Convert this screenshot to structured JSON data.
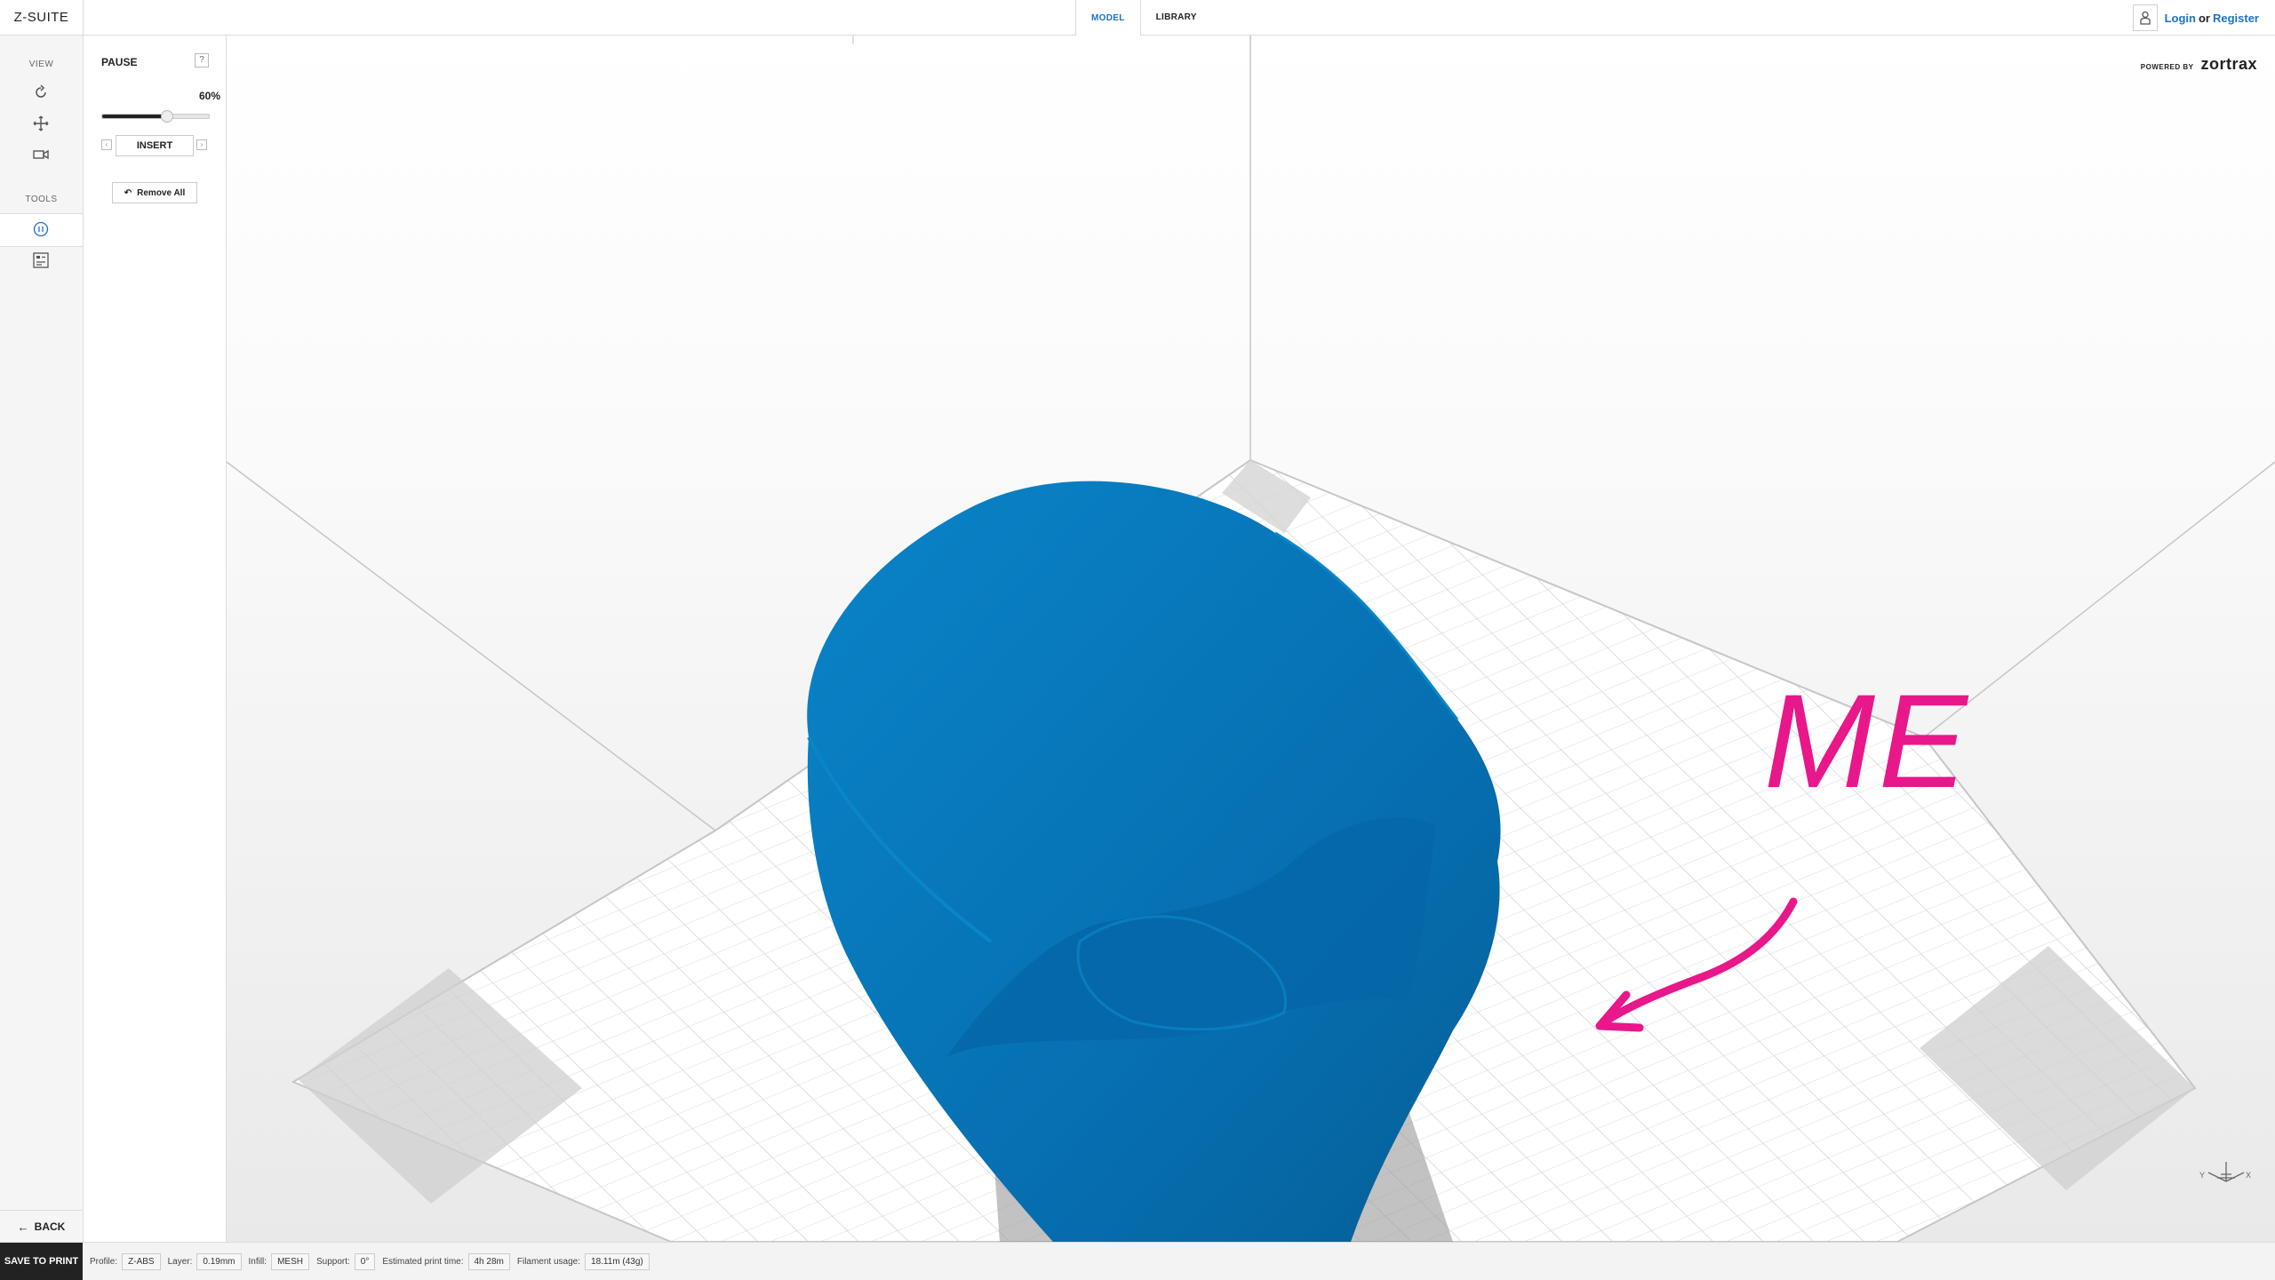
{
  "app": {
    "logo": "Z-SUITE"
  },
  "tabs": [
    {
      "label": "MODEL"
    },
    {
      "label": "LIBRARY"
    }
  ],
  "user": {
    "login": "Login",
    "or": "or",
    "register": "Register"
  },
  "left": {
    "view_label": "VIEW",
    "tools_label": "TOOLS",
    "back_label": "BACK"
  },
  "panel": {
    "title": "PAUSE",
    "help": "?",
    "percent": "60%",
    "percent_value": 0.6,
    "insert_label": "INSERT",
    "remove_all_label": "Remove All"
  },
  "viewport": {
    "powered_by": "POWERED BY",
    "brand": "zortrax",
    "annotation": "ME",
    "annotation_color": "#e8178a",
    "model_color": "#0675b8"
  },
  "status": {
    "save_label": "SAVE TO PRINT",
    "profile_label": "Profile:",
    "profile": "Z-ABS",
    "layer_label": "Layer:",
    "layer": "0.19mm",
    "infill_label": "Infill:",
    "infill": "MESH",
    "support_label": "Support:",
    "support": "0°",
    "time_label": "Estimated print time:",
    "time": "4h 28m",
    "filament_label": "Filament usage:",
    "filament": "18.11m (43g)"
  }
}
